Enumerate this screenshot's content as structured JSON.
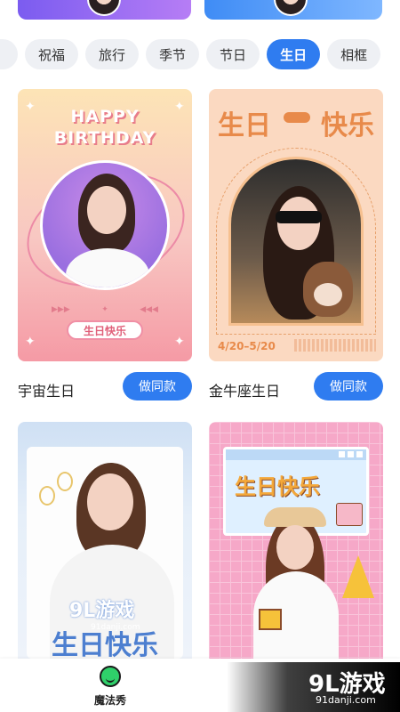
{
  "tabs": [
    {
      "label": "祝福",
      "active": false
    },
    {
      "label": "旅行",
      "active": false
    },
    {
      "label": "季节",
      "active": false
    },
    {
      "label": "节日",
      "active": false
    },
    {
      "label": "生日",
      "active": true
    },
    {
      "label": "相框",
      "active": false
    }
  ],
  "cards": [
    {
      "title": "宇宙生日",
      "button": "做同款",
      "thumb": {
        "line1": "HAPPY",
        "line2": "BIRTHDAY",
        "pill": "生日快乐"
      }
    },
    {
      "title": "金牛座生日",
      "button": "做同款",
      "thumb": {
        "left": "生日",
        "right": "快乐",
        "date": "4/20–5/20"
      }
    },
    {
      "thumb": {
        "text": "生日快乐"
      }
    },
    {
      "thumb": {
        "text": "生日快乐"
      }
    }
  ],
  "bottom_nav": {
    "label": "魔法秀",
    "icon": "smile-icon"
  },
  "watermark": {
    "logo": "9L游戏",
    "site": "91danji.com"
  },
  "colors": {
    "accent": "#2f7cf0",
    "tab_bg": "#eef0f4"
  }
}
